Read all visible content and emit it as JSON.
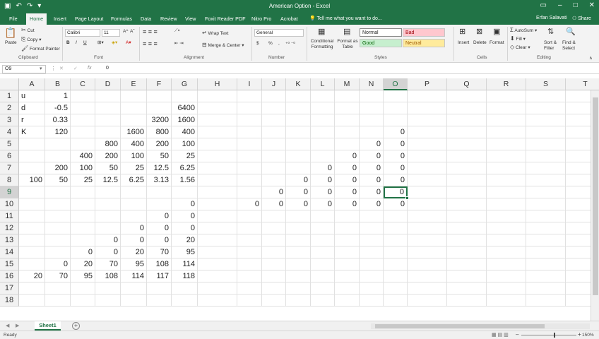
{
  "window": {
    "title": "American Option - Excel",
    "user": "Erfan Salavati",
    "share": "Share",
    "tell_me": "Tell me what you want to do..."
  },
  "tabs": [
    "File",
    "Home",
    "Insert",
    "Page Layout",
    "Formulas",
    "Data",
    "Review",
    "View",
    "Foxit Reader PDF",
    "Nitro Pro",
    "Acrobat"
  ],
  "ribbon": {
    "clipboard": {
      "paste": "Paste",
      "cut": "Cut",
      "copy": "Copy",
      "format_painter": "Format Painter",
      "label": "Clipboard"
    },
    "font": {
      "name": "Calibri",
      "size": "11",
      "label": "Font",
      "bold": "B",
      "italic": "I",
      "underline": "U"
    },
    "alignment": {
      "wrap": "Wrap Text",
      "merge": "Merge & Center",
      "label": "Alignment"
    },
    "number": {
      "format": "General",
      "currency": "$",
      "percent": "%",
      "comma": ",",
      "label": "Number"
    },
    "styles": {
      "conditional": "Conditional Formatting",
      "format_table": "Format as Table",
      "normal": "Normal",
      "bad": "Bad",
      "good": "Good",
      "neutral": "Neutral",
      "label": "Styles"
    },
    "cells": {
      "insert": "Insert",
      "delete": "Delete",
      "format": "Format",
      "label": "Cells"
    },
    "editing": {
      "autosum": "AutoSum",
      "fill": "Fill",
      "clear": "Clear",
      "sort": "Sort & Filter",
      "find": "Find & Select",
      "label": "Editing"
    }
  },
  "formula_bar": {
    "name_box": "O9",
    "fx": "fx",
    "value": "0"
  },
  "columns": [
    "A",
    "B",
    "C",
    "D",
    "E",
    "F",
    "G",
    "H",
    "I",
    "J",
    "K",
    "L",
    "M",
    "N",
    "O",
    "P",
    "Q",
    "R",
    "S",
    "T"
  ],
  "rows": [
    "1",
    "2",
    "3",
    "4",
    "5",
    "6",
    "7",
    "8",
    "9",
    "10",
    "11",
    "12",
    "13",
    "14",
    "15",
    "16",
    "17",
    "18"
  ],
  "cells": [
    {
      "ref": "A1",
      "v": "u",
      "t": "txt"
    },
    {
      "ref": "B1",
      "v": "1",
      "t": "num"
    },
    {
      "ref": "A2",
      "v": "d",
      "t": "txt"
    },
    {
      "ref": "B2",
      "v": "-0.5",
      "t": "num"
    },
    {
      "ref": "G2",
      "v": "6400",
      "t": "num"
    },
    {
      "ref": "A3",
      "v": "r",
      "t": "txt"
    },
    {
      "ref": "B3",
      "v": "0.33",
      "t": "num"
    },
    {
      "ref": "F3",
      "v": "3200",
      "t": "num"
    },
    {
      "ref": "G3",
      "v": "1600",
      "t": "num"
    },
    {
      "ref": "A4",
      "v": "K",
      "t": "txt"
    },
    {
      "ref": "B4",
      "v": "120",
      "t": "num"
    },
    {
      "ref": "E4",
      "v": "1600",
      "t": "num"
    },
    {
      "ref": "F4",
      "v": "800",
      "t": "num"
    },
    {
      "ref": "G4",
      "v": "400",
      "t": "num"
    },
    {
      "ref": "O4",
      "v": "0",
      "t": "num"
    },
    {
      "ref": "D5",
      "v": "800",
      "t": "num"
    },
    {
      "ref": "E5",
      "v": "400",
      "t": "num"
    },
    {
      "ref": "F5",
      "v": "200",
      "t": "num"
    },
    {
      "ref": "G5",
      "v": "100",
      "t": "num"
    },
    {
      "ref": "N5",
      "v": "0",
      "t": "num"
    },
    {
      "ref": "O5",
      "v": "0",
      "t": "num"
    },
    {
      "ref": "C6",
      "v": "400",
      "t": "num"
    },
    {
      "ref": "D6",
      "v": "200",
      "t": "num"
    },
    {
      "ref": "E6",
      "v": "100",
      "t": "num"
    },
    {
      "ref": "F6",
      "v": "50",
      "t": "num"
    },
    {
      "ref": "G6",
      "v": "25",
      "t": "num"
    },
    {
      "ref": "M6",
      "v": "0",
      "t": "num"
    },
    {
      "ref": "N6",
      "v": "0",
      "t": "num"
    },
    {
      "ref": "O6",
      "v": "0",
      "t": "num"
    },
    {
      "ref": "B7",
      "v": "200",
      "t": "num"
    },
    {
      "ref": "C7",
      "v": "100",
      "t": "num"
    },
    {
      "ref": "D7",
      "v": "50",
      "t": "num"
    },
    {
      "ref": "E7",
      "v": "25",
      "t": "num"
    },
    {
      "ref": "F7",
      "v": "12.5",
      "t": "num"
    },
    {
      "ref": "G7",
      "v": "6.25",
      "t": "num"
    },
    {
      "ref": "L7",
      "v": "0",
      "t": "num"
    },
    {
      "ref": "M7",
      "v": "0",
      "t": "num"
    },
    {
      "ref": "N7",
      "v": "0",
      "t": "num"
    },
    {
      "ref": "O7",
      "v": "0",
      "t": "num"
    },
    {
      "ref": "A8",
      "v": "100",
      "t": "num"
    },
    {
      "ref": "B8",
      "v": "50",
      "t": "num"
    },
    {
      "ref": "C8",
      "v": "25",
      "t": "num"
    },
    {
      "ref": "D8",
      "v": "12.5",
      "t": "num"
    },
    {
      "ref": "E8",
      "v": "6.25",
      "t": "num"
    },
    {
      "ref": "F8",
      "v": "3.13",
      "t": "num"
    },
    {
      "ref": "G8",
      "v": "1.56",
      "t": "num"
    },
    {
      "ref": "K8",
      "v": "0",
      "t": "num"
    },
    {
      "ref": "L8",
      "v": "0",
      "t": "num"
    },
    {
      "ref": "M8",
      "v": "0",
      "t": "num"
    },
    {
      "ref": "N8",
      "v": "0",
      "t": "num"
    },
    {
      "ref": "O8",
      "v": "0",
      "t": "num"
    },
    {
      "ref": "J9",
      "v": "0",
      "t": "num"
    },
    {
      "ref": "K9",
      "v": "0",
      "t": "num"
    },
    {
      "ref": "L9",
      "v": "0",
      "t": "num"
    },
    {
      "ref": "M9",
      "v": "0",
      "t": "num"
    },
    {
      "ref": "N9",
      "v": "0",
      "t": "num"
    },
    {
      "ref": "O9",
      "v": "0",
      "t": "num"
    },
    {
      "ref": "G10",
      "v": "0",
      "t": "num"
    },
    {
      "ref": "I10",
      "v": "0",
      "t": "num"
    },
    {
      "ref": "J10",
      "v": "0",
      "t": "num"
    },
    {
      "ref": "K10",
      "v": "0",
      "t": "num"
    },
    {
      "ref": "L10",
      "v": "0",
      "t": "num"
    },
    {
      "ref": "M10",
      "v": "0",
      "t": "num"
    },
    {
      "ref": "N10",
      "v": "0",
      "t": "num"
    },
    {
      "ref": "O10",
      "v": "0",
      "t": "num"
    },
    {
      "ref": "F11",
      "v": "0",
      "t": "num"
    },
    {
      "ref": "G11",
      "v": "0",
      "t": "num"
    },
    {
      "ref": "E12",
      "v": "0",
      "t": "num"
    },
    {
      "ref": "F12",
      "v": "0",
      "t": "num"
    },
    {
      "ref": "G12",
      "v": "0",
      "t": "num"
    },
    {
      "ref": "D13",
      "v": "0",
      "t": "num"
    },
    {
      "ref": "E13",
      "v": "0",
      "t": "num"
    },
    {
      "ref": "F13",
      "v": "0",
      "t": "num"
    },
    {
      "ref": "G13",
      "v": "20",
      "t": "num"
    },
    {
      "ref": "C14",
      "v": "0",
      "t": "num"
    },
    {
      "ref": "D14",
      "v": "0",
      "t": "num"
    },
    {
      "ref": "E14",
      "v": "20",
      "t": "num"
    },
    {
      "ref": "F14",
      "v": "70",
      "t": "num"
    },
    {
      "ref": "G14",
      "v": "95",
      "t": "num"
    },
    {
      "ref": "B15",
      "v": "0",
      "t": "num"
    },
    {
      "ref": "C15",
      "v": "20",
      "t": "num"
    },
    {
      "ref": "D15",
      "v": "70",
      "t": "num"
    },
    {
      "ref": "E15",
      "v": "95",
      "t": "num"
    },
    {
      "ref": "F15",
      "v": "108",
      "t": "num"
    },
    {
      "ref": "G15",
      "v": "114",
      "t": "num"
    },
    {
      "ref": "A16",
      "v": "20",
      "t": "num"
    },
    {
      "ref": "B16",
      "v": "70",
      "t": "num"
    },
    {
      "ref": "C16",
      "v": "95",
      "t": "num"
    },
    {
      "ref": "D16",
      "v": "108",
      "t": "num"
    },
    {
      "ref": "E16",
      "v": "114",
      "t": "num"
    },
    {
      "ref": "F16",
      "v": "117",
      "t": "num"
    },
    {
      "ref": "G16",
      "v": "118",
      "t": "num"
    }
  ],
  "active_cell": "O9",
  "sheet": {
    "name": "Sheet1",
    "add": "+"
  },
  "status": {
    "ready": "Ready",
    "zoom": "150%"
  },
  "colors": {
    "excel_green": "#217346",
    "bad_fill": "#ffc7ce",
    "good_fill": "#c6efce",
    "neutral_fill": "#ffeb9c"
  }
}
